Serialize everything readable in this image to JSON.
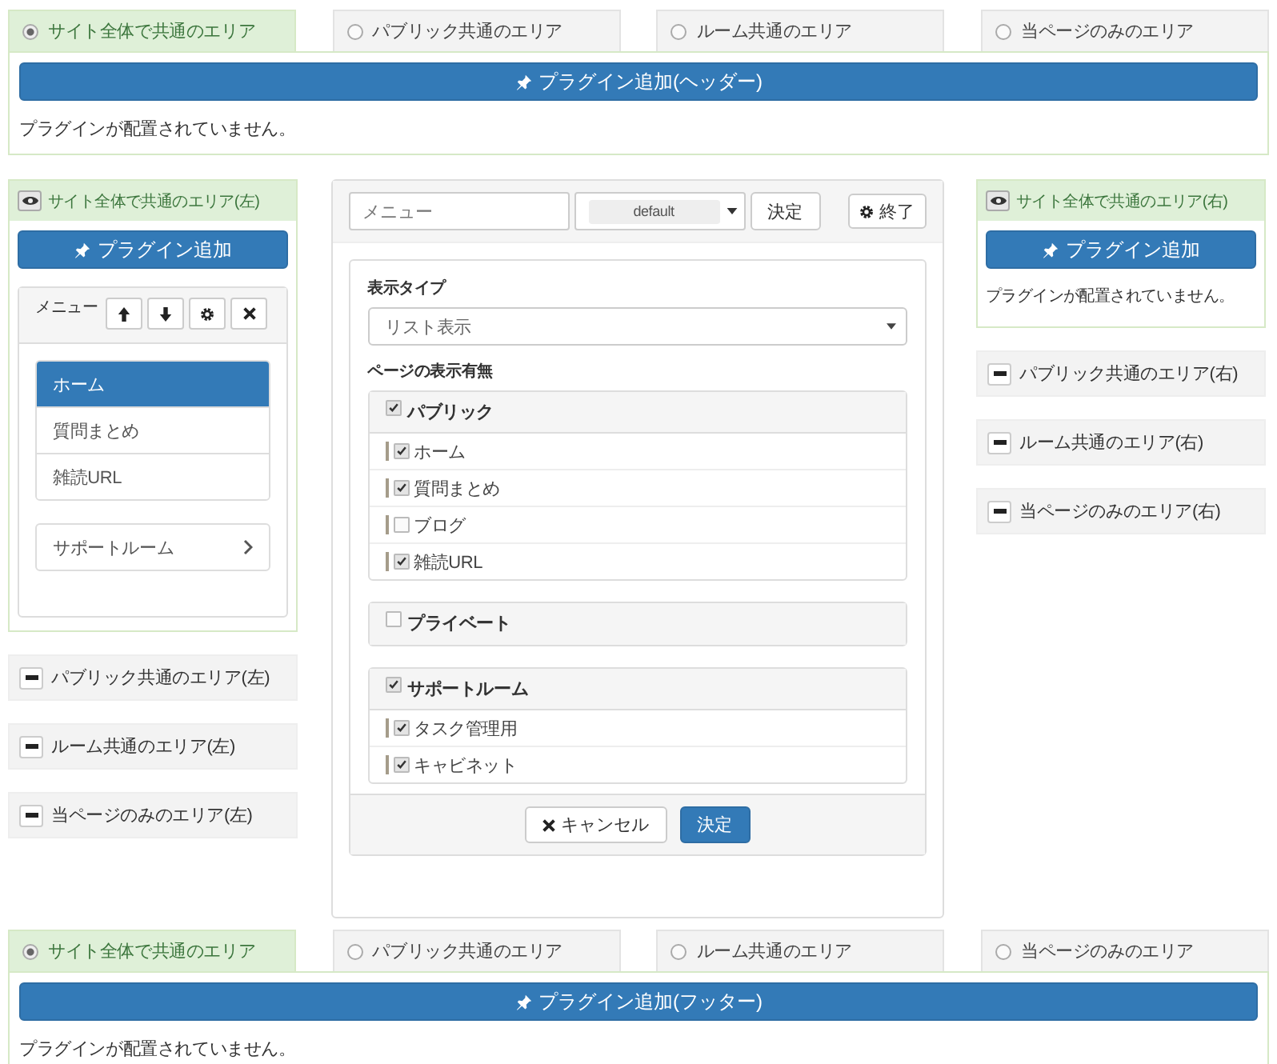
{
  "header": {
    "tabs": [
      {
        "label": "サイト全体で共通のエリア",
        "selected": true
      },
      {
        "label": "パブリック共通のエリア",
        "selected": false
      },
      {
        "label": "ルーム共通のエリア",
        "selected": false
      },
      {
        "label": "当ページのみのエリア",
        "selected": false
      }
    ],
    "add_button": "プラグイン追加(ヘッダー)",
    "message": "プラグインが配置されていません。"
  },
  "left": {
    "title": "サイト全体で共通のエリア(左)",
    "add_button": "プラグイン追加",
    "menu_plugin": {
      "title": "メニュー",
      "items": [
        {
          "label": "ホーム",
          "selected": true
        },
        {
          "label": "質問まとめ",
          "selected": false
        },
        {
          "label": "雑読URL",
          "selected": false
        }
      ],
      "sub_item": "サポートルーム"
    },
    "areas": [
      "パブリック共通のエリア(左)",
      "ルーム共通のエリア(左)",
      "当ページのみのエリア(左)"
    ]
  },
  "editor": {
    "name": "メニュー",
    "frame": "default",
    "apply_button": "決定",
    "end_button": "終了",
    "display_type_label": "表示タイプ",
    "display_type": "リスト表示",
    "visibility_label": "ページの表示有無",
    "groups": [
      {
        "label": "パブリック",
        "checked": true,
        "pages": [
          {
            "label": "ホーム",
            "checked": true
          },
          {
            "label": "質問まとめ",
            "checked": true
          },
          {
            "label": "ブログ",
            "checked": false
          },
          {
            "label": "雑読URL",
            "checked": true
          }
        ]
      },
      {
        "label": "プライベート",
        "checked": false
      },
      {
        "label": "サポートルーム",
        "checked": true,
        "pages": [
          {
            "label": "タスク管理用",
            "checked": true
          },
          {
            "label": "キャビネット",
            "checked": true
          }
        ]
      }
    ],
    "cancel_button": "キャンセル",
    "submit_button": "決定"
  },
  "right": {
    "title": "サイト全体で共通のエリア(右)",
    "add_button": "プラグイン追加",
    "message": "プラグインが配置されていません。",
    "areas": [
      "パブリック共通のエリア(右)",
      "ルーム共通のエリア(右)",
      "当ページのみのエリア(右)"
    ]
  },
  "footer": {
    "tabs": [
      {
        "label": "サイト全体で共通のエリア",
        "selected": true
      },
      {
        "label": "パブリック共通のエリア",
        "selected": false
      },
      {
        "label": "ルーム共通のエリア",
        "selected": false
      },
      {
        "label": "当ページのみのエリア",
        "selected": false
      }
    ],
    "add_button": "プラグイン追加(フッター)",
    "message": "プラグインが配置されていません。"
  }
}
